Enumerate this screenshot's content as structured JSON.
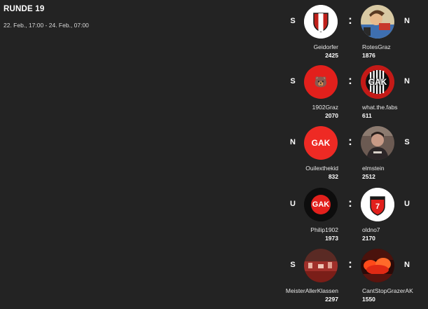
{
  "round": {
    "title": "RUNDE 19",
    "dates": "22. Feb., 17:00 - 24. Feb., 07:00"
  },
  "separator": ":",
  "matches": [
    {
      "home": {
        "result": "S",
        "name": "Geidorfer",
        "score": "2425",
        "avatar": "shield-icon"
      },
      "away": {
        "result": "N",
        "name": "RotesGraz",
        "score": "1876",
        "avatar": "cartoon-photo"
      }
    },
    {
      "home": {
        "result": "S",
        "name": "1902Graz",
        "score": "2070",
        "avatar": "bear-emoji",
        "avatar_text": "🐻"
      },
      "away": {
        "result": "N",
        "name": "what.the.fabs",
        "score": "611",
        "avatar": "gak-striped-crest",
        "avatar_text": "GAK"
      }
    },
    {
      "home": {
        "result": "N",
        "name": "Ouilexthekid",
        "score": "832",
        "avatar": "gak-red-logo",
        "avatar_text": "GAK"
      },
      "away": {
        "result": "S",
        "name": "elmstein",
        "score": "2512",
        "avatar": "person-photo"
      }
    },
    {
      "home": {
        "result": "U",
        "name": "Philip1902",
        "score": "1973",
        "avatar": "gak-dark-logo",
        "avatar_text": "GAK"
      },
      "away": {
        "result": "U",
        "name": "oldno7",
        "score": "2170",
        "avatar": "shield-seven-icon",
        "avatar_text": "7"
      }
    },
    {
      "home": {
        "result": "S",
        "name": "MeisterAllerKlassen",
        "score": "2297",
        "avatar": "stadium-photo"
      },
      "away": {
        "result": "N",
        "name": "CantStopGrazerAK",
        "score": "1550",
        "avatar": "fans-pyro-photo"
      }
    }
  ],
  "colors": {
    "background": "#232323",
    "gak_red": "#e2201c",
    "text": "#ffffff"
  }
}
